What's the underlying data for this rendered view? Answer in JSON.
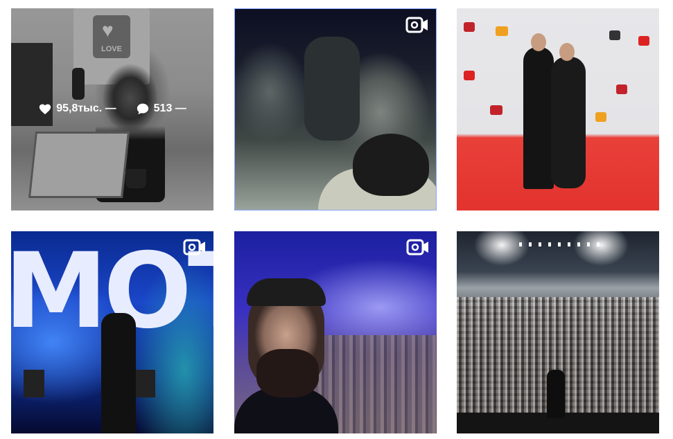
{
  "grid": {
    "posts": [
      {
        "type": "photo",
        "hovered": true,
        "likes": "95,8тыс. —",
        "comments": "513 —",
        "badge_text": "LOVE",
        "icon": "none"
      },
      {
        "type": "video",
        "hovered": false,
        "icon": "video-camera-icon"
      },
      {
        "type": "photo",
        "hovered": false,
        "icon": "none"
      },
      {
        "type": "video",
        "hovered": false,
        "icon": "video-camera-icon",
        "stage_text": "MOT"
      },
      {
        "type": "video",
        "hovered": false,
        "icon": "video-camera-icon"
      },
      {
        "type": "photo",
        "hovered": false,
        "icon": "none"
      }
    ]
  },
  "colors": {
    "background": "#ffffff",
    "overlay_text": "#ffffff",
    "selected_border": "#88a6ff"
  }
}
